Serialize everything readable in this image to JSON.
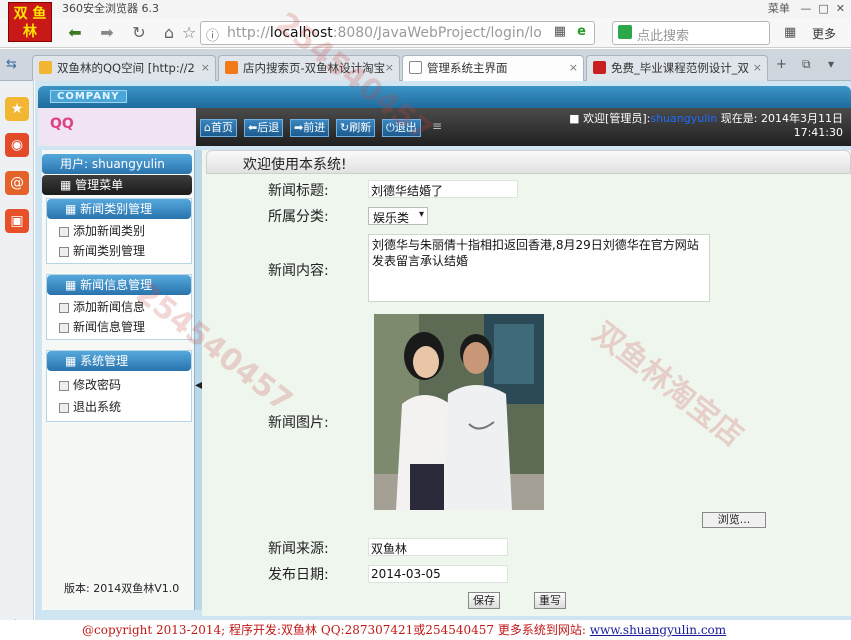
{
  "browser": {
    "title": "360安全浏览器 6.3",
    "logo_lines": [
      "双 鱼",
      "林"
    ],
    "menu_label": "菜单",
    "address_prefix": "http://",
    "address_host": "localhost",
    "address_rest": ":8080/JavaWebProject/login/lo",
    "search_placeholder": "点此搜索",
    "more_label": "更多",
    "tabs": [
      {
        "label": "双鱼林的QQ空间 [http://2",
        "active": false,
        "icon_color": "#f2b632"
      },
      {
        "label": "店内搜索页-双鱼林设计淘宝",
        "active": false,
        "icon_color": "#f07a1a"
      },
      {
        "label": "管理系统主界面",
        "active": true,
        "icon_color": "#e8e8e8"
      },
      {
        "label": "免费_毕业课程范例设计_双",
        "active": false,
        "icon_color": "#c82020"
      }
    ]
  },
  "app": {
    "company_label": "COMPANY",
    "logo_text": "QQ",
    "nav_buttons": [
      "首页",
      "后退",
      "前进",
      "刷新",
      "退出"
    ],
    "welcome_prefix": "欢迎[管理员]:",
    "welcome_user": "shuangyulin",
    "welcome_date": "现在是: 2014年3月11日",
    "welcome_time": "17:41:30"
  },
  "sidebar": {
    "user_label": "用户: shuangyulin",
    "admin_menu": "管理菜单",
    "groups": [
      {
        "title": "新闻类别管理",
        "items": [
          "添加新闻类别",
          "新闻类别管理"
        ]
      },
      {
        "title": "新闻信息管理",
        "items": [
          "添加新闻信息",
          "新闻信息管理"
        ]
      },
      {
        "title": "系统管理",
        "items": [
          "修改密码",
          "退出系统"
        ]
      }
    ],
    "version": "版本: 2014双鱼林V1.0"
  },
  "main": {
    "title": "欢迎使用本系统!",
    "fields": {
      "news_title_label": "新闻标题:",
      "news_title_value": "刘德华结婚了",
      "category_label": "所属分类:",
      "category_value": "娱乐类",
      "content_label": "新闻内容:",
      "content_value": "刘德华与朱丽倩十指相扣返回香港,8月29日刘德华在官方网站发表留言承认结婚",
      "image_label": "新闻图片:",
      "browse_button": "浏览...",
      "source_label": "新闻来源:",
      "source_value": "双鱼林",
      "date_label": "发布日期:",
      "date_value": "2014-03-05"
    },
    "save_button": "保存",
    "reset_button": "重写"
  },
  "footer": {
    "copyright": "@copyright 2013-2014;  程序开发:双鱼林  QQ:287307421或254540457  更多系统到网站:",
    "url": "www.shuangyulin.com"
  },
  "watermark": [
    "254540457",
    "双鱼林淘宝店"
  ]
}
